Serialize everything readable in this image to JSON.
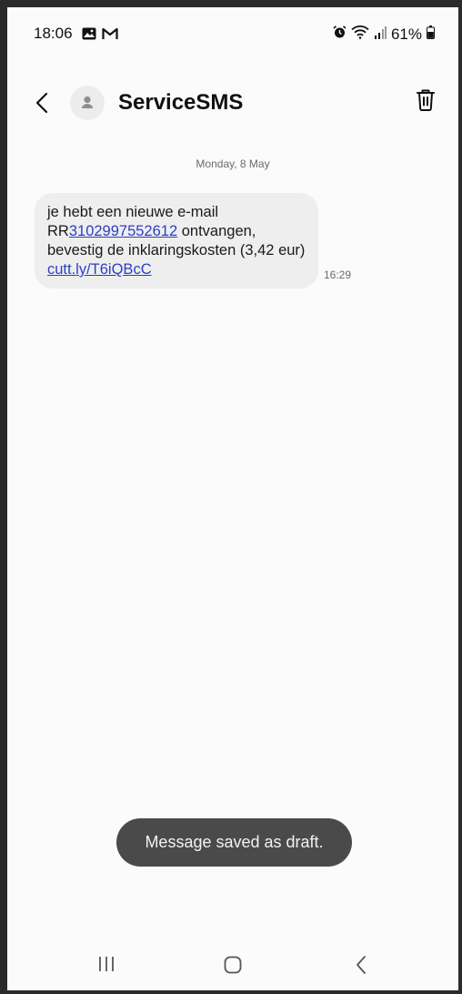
{
  "status_bar": {
    "time": "18:06",
    "battery_percent": "61%",
    "icons_left": [
      "gallery-icon",
      "gmail-icon"
    ],
    "icons_right": [
      "alarm-icon",
      "wifi-icon",
      "signal-icon",
      "battery-icon"
    ]
  },
  "header": {
    "contact_name": "ServiceSMS",
    "icons": [
      "back-arrow-icon",
      "contact-avatar-icon",
      "trash-icon"
    ]
  },
  "conversation": {
    "date_separator": "Monday, 8 May",
    "messages": [
      {
        "text_1": "je hebt een nieuwe e-mail RR",
        "link_number": "3102997552612",
        "text_2": " ontvangen, bevestig de inklaringskosten (3,42 eur) ",
        "link_url": "cutt.ly/T6iQBcC",
        "time": "16:29",
        "direction": "incoming"
      }
    ]
  },
  "toast": {
    "text": "Message saved as draft."
  },
  "nav_bar": {
    "icons": [
      "recents-icon",
      "home-icon",
      "back-icon"
    ]
  },
  "colors": {
    "bubble_bg": "#eeeeee",
    "link": "#2b3fc7",
    "toast_bg": "#4a4a4a",
    "screen_bg": "#fbfbfb"
  }
}
